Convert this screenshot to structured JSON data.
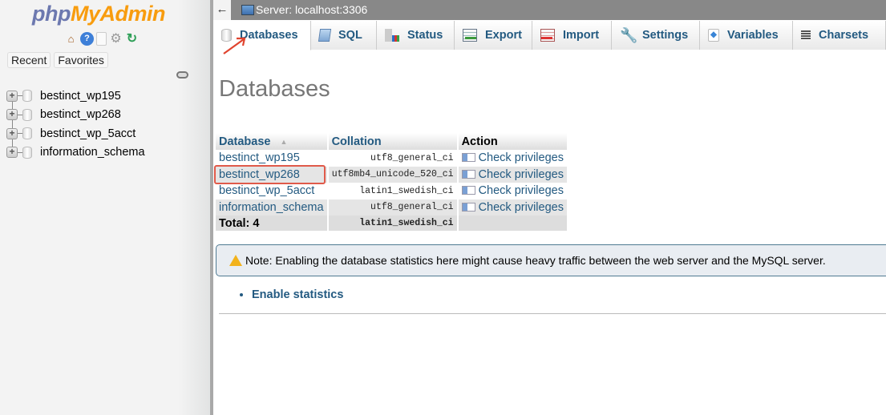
{
  "sidebar": {
    "logo_part1": "php",
    "logo_part2": "MyAdmin",
    "nav_icons": [
      "home-icon",
      "help-icon",
      "documentation-icon",
      "settings-icon",
      "reload-icon"
    ],
    "recent_label": "Recent",
    "favorites_label": "Favorites",
    "databases": [
      {
        "name": "bestinct_wp195"
      },
      {
        "name": "bestinct_wp268"
      },
      {
        "name": "bestinct_wp_5acct"
      },
      {
        "name": "information_schema"
      }
    ]
  },
  "topbar": {
    "back_label": "←",
    "server_label": "Server: localhost:3306"
  },
  "tabs": [
    {
      "label": "Databases",
      "icon": "database-icon",
      "active": true
    },
    {
      "label": "SQL",
      "icon": "sql-icon"
    },
    {
      "label": "Status",
      "icon": "status-icon"
    },
    {
      "label": "Export",
      "icon": "export-icon"
    },
    {
      "label": "Import",
      "icon": "import-icon"
    },
    {
      "label": "Settings",
      "icon": "wrench-icon"
    },
    {
      "label": "Variables",
      "icon": "variables-icon"
    },
    {
      "label": "Charsets",
      "icon": "charsets-icon"
    }
  ],
  "main": {
    "title": "Databases",
    "table": {
      "headers": {
        "database": "Database",
        "collation": "Collation",
        "action": "Action"
      },
      "rows": [
        {
          "name": "bestinct_wp195",
          "collation": "utf8_general_ci",
          "action": "Check privileges"
        },
        {
          "name": "bestinct_wp268",
          "collation": "utf8mb4_unicode_520_ci",
          "action": "Check privileges"
        },
        {
          "name": "bestinct_wp_5acct",
          "collation": "latin1_swedish_ci",
          "action": "Check privileges"
        },
        {
          "name": "information_schema",
          "collation": "utf8_general_ci",
          "action": "Check privileges"
        }
      ],
      "total_label": "Total: 4",
      "total_collation": "latin1_swedish_ci"
    },
    "notice": "Note: Enabling the database statistics here might cause heavy traffic between the web server and the MySQL server.",
    "enable_statistics": "Enable statistics"
  },
  "colors": {
    "link": "#235a81",
    "highlight": "#e05a4a",
    "logo_php": "#6c78af",
    "logo_myadmin": "#f89c0e"
  }
}
